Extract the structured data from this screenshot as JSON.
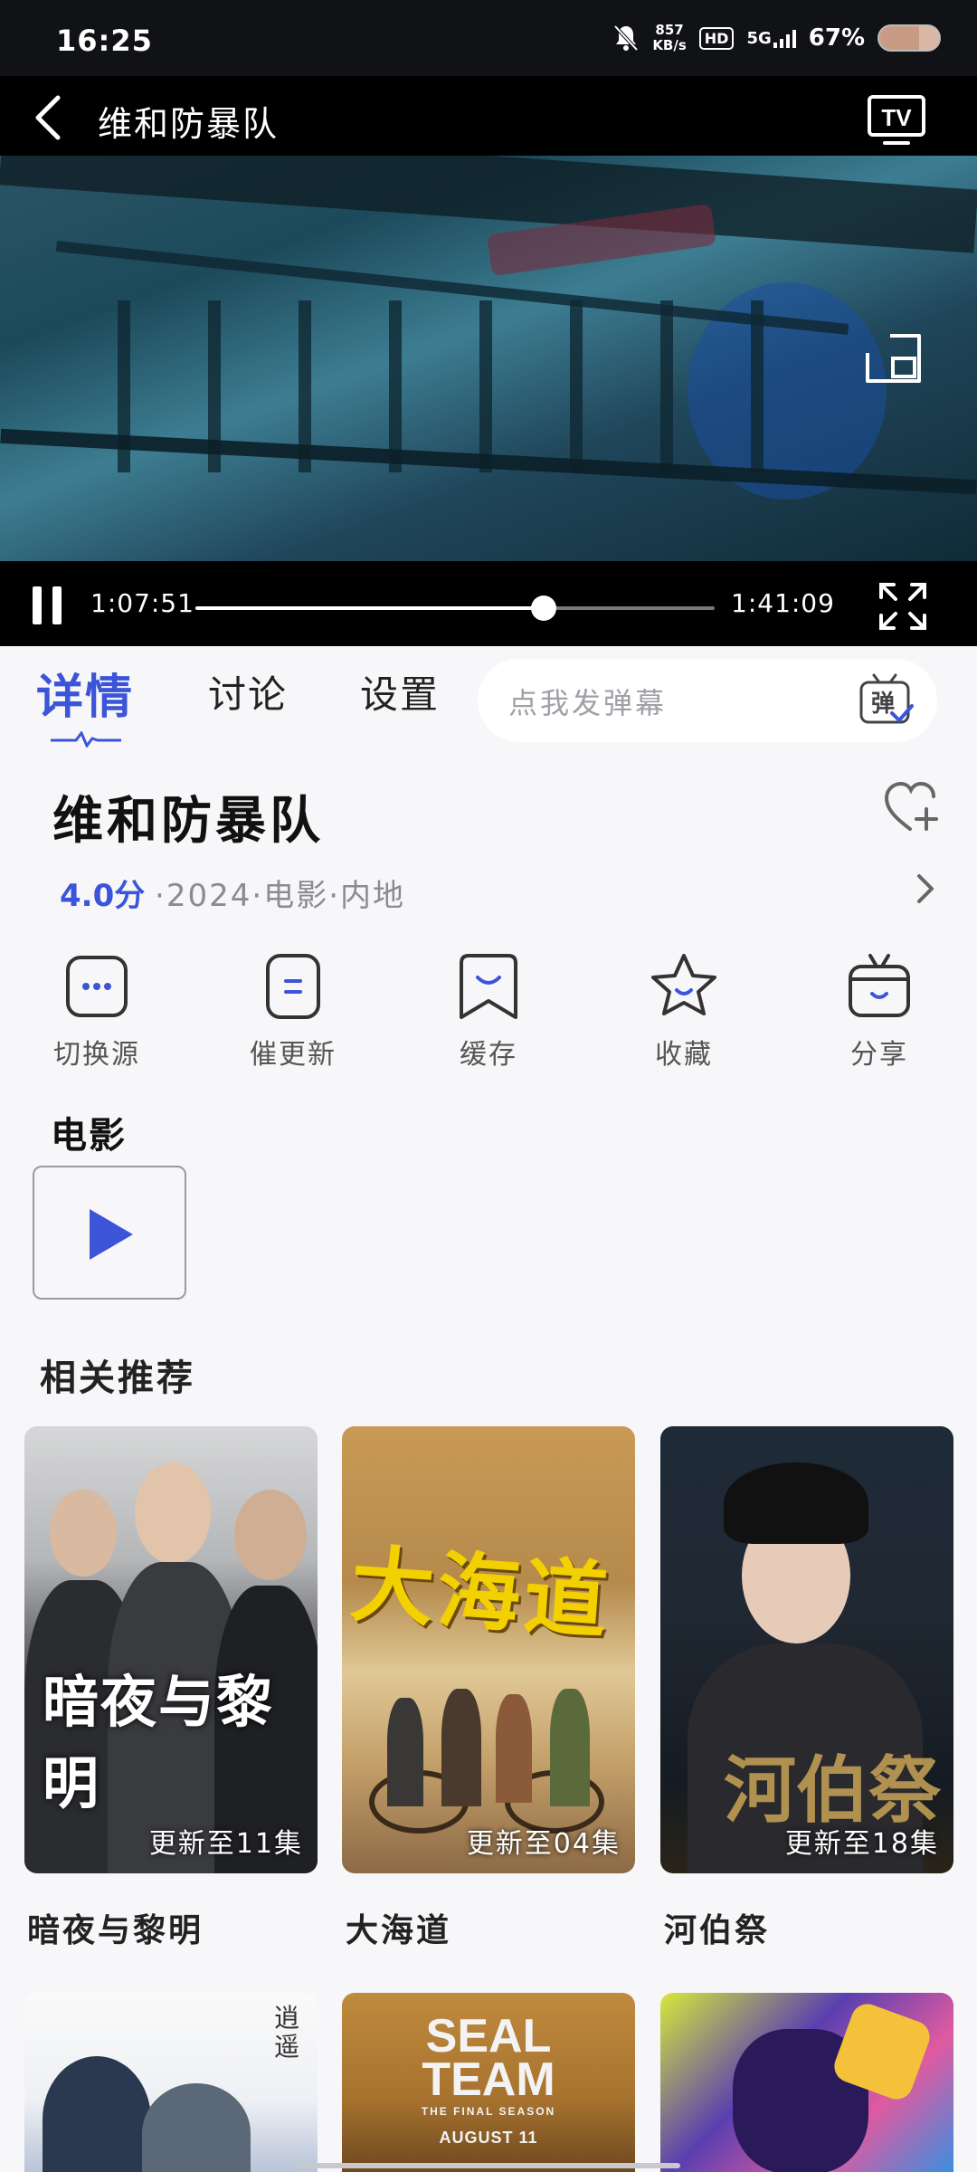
{
  "status_bar": {
    "time": "16:25",
    "net_speed_value": "857",
    "net_speed_unit": "KB/s",
    "hd": "HD",
    "network": "5G",
    "battery_text": "67%",
    "battery_level": 0.67
  },
  "player": {
    "title": "维和防暴队",
    "tv_label": "TV",
    "current_time": "1:07:51",
    "total_time": "1:41:09",
    "progress": 0.67
  },
  "tabs": {
    "details": "详情",
    "discuss": "讨论",
    "settings": "设置",
    "danmu_placeholder": "点我发弹幕",
    "danmu_icon_text": "弹"
  },
  "info": {
    "title": "维和防暴队",
    "score": "4.0分",
    "meta": "·2024·电影·内地"
  },
  "actions": [
    {
      "label": "切换源",
      "icon": "more-dots-icon"
    },
    {
      "label": "催更新",
      "icon": "update-icon"
    },
    {
      "label": "缓存",
      "icon": "download-cache-icon"
    },
    {
      "label": "收藏",
      "icon": "star-icon"
    },
    {
      "label": "分享",
      "icon": "share-tv-icon"
    }
  ],
  "movie_section": {
    "heading": "电影"
  },
  "recommendations": {
    "heading": "相关推荐",
    "items": [
      {
        "title": "暗夜与黎明",
        "badge": "更新至11集",
        "poster_text": "暗夜与黎明"
      },
      {
        "title": "大海道",
        "badge": "更新至04集",
        "poster_text": "大海道"
      },
      {
        "title": "河伯祭",
        "badge": "更新至18集",
        "poster_text": "河伯祭"
      }
    ],
    "row2": [
      {
        "poster_text": "逍遥"
      },
      {
        "line1": "SEAL",
        "line2": "TEAM",
        "line3": "THE FINAL SEASON",
        "line4": "AUGUST 11"
      },
      {
        "poster_text": ""
      }
    ]
  }
}
